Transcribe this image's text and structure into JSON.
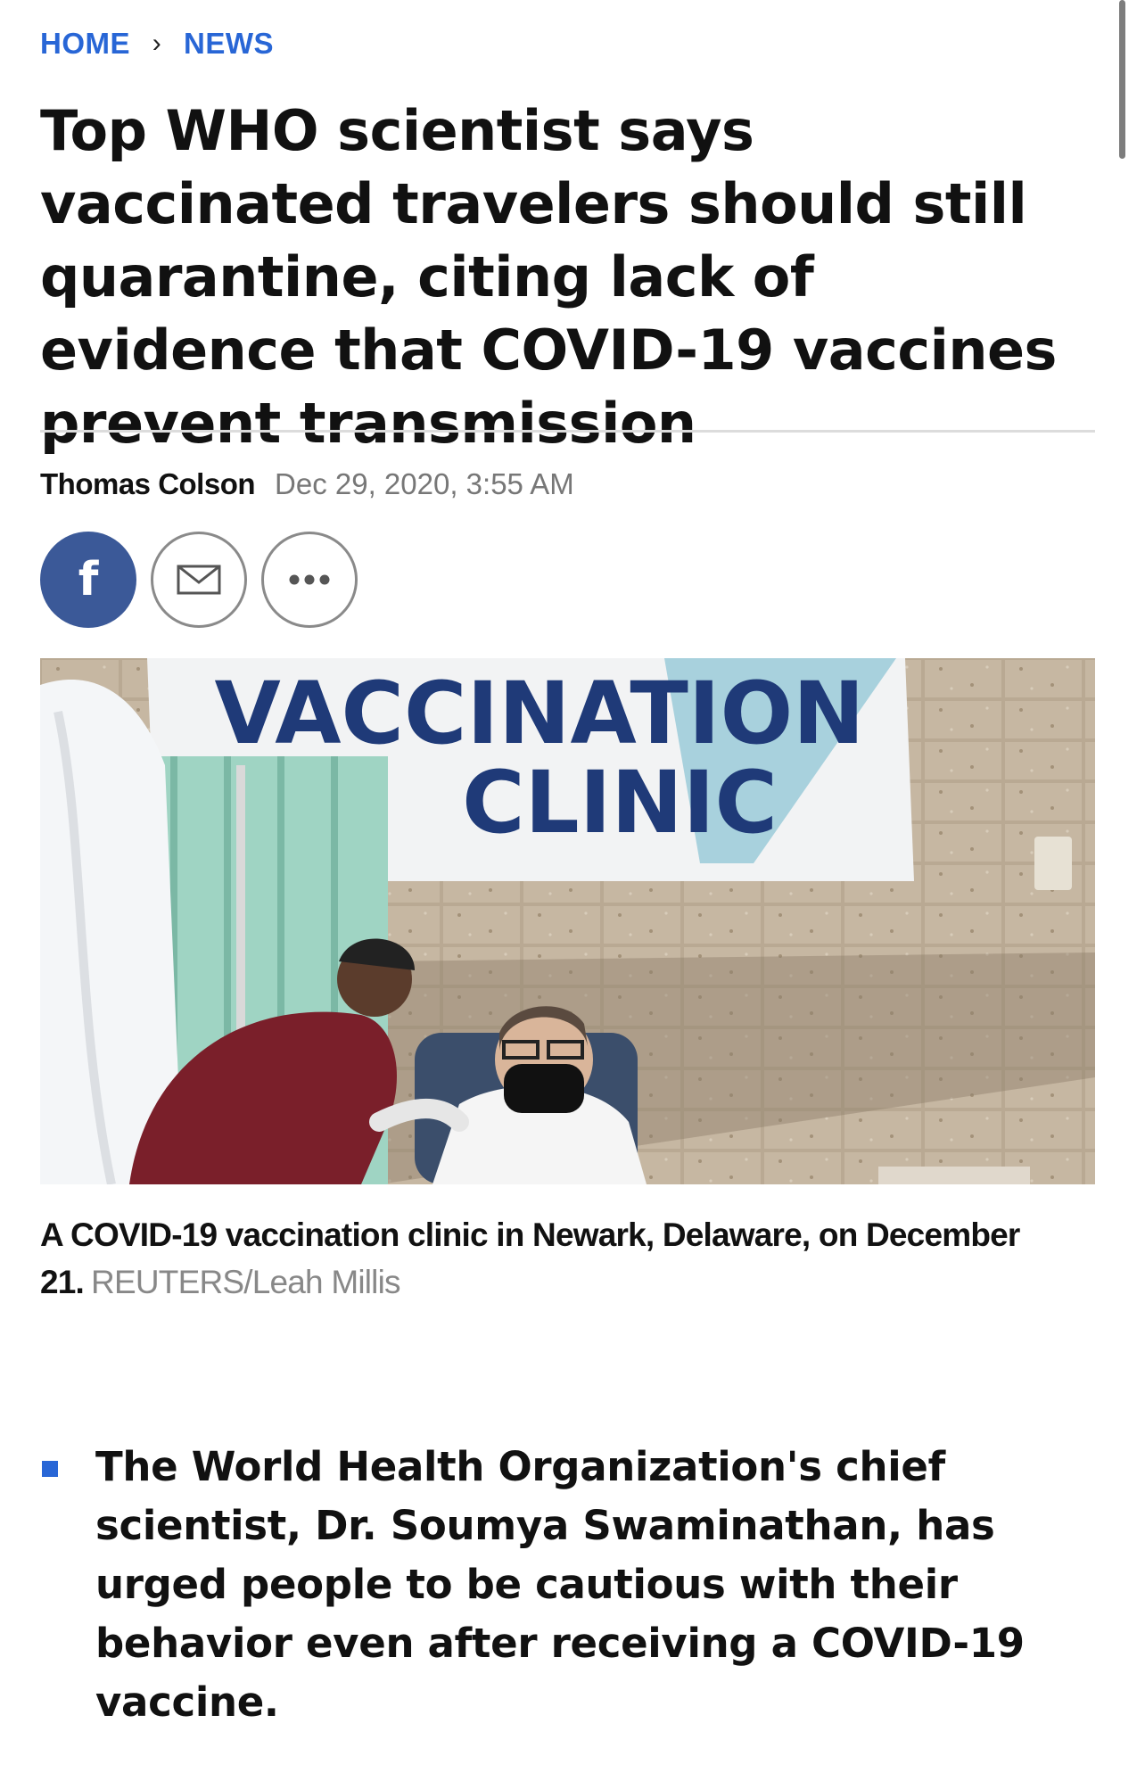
{
  "breadcrumb": {
    "home": "HOME",
    "separator": "›",
    "section": "NEWS"
  },
  "article": {
    "headline": "Top WHO scientist says vaccinated travelers should still quarantine, citing lack of evidence that COVID-19 vaccines prevent transmission",
    "author": "Thomas Colson",
    "date": "Dec 29, 2020, 3:55 AM"
  },
  "share": {
    "facebook_glyph": "f",
    "facebook_icon": "facebook-icon",
    "email_icon": "mail-icon",
    "more_icon": "more-horizontal-icon",
    "facebook_color": "#3b5998"
  },
  "figure": {
    "banner_line1": "VACCINATION",
    "banner_line2": "CLINIC",
    "caption": "A COVID-19 vaccination clinic in Newark, Delaware, on December 21.",
    "credit": "REUTERS/Leah Millis"
  },
  "bullets": [
    "The World Health Organization's chief scientist, Dr. Soumya Swaminathan, has urged people to be cautious with their behavior even after receiving a COVID-19 vaccine."
  ],
  "colors": {
    "accent": "#2866d6",
    "text": "#111111",
    "muted": "#777777"
  }
}
